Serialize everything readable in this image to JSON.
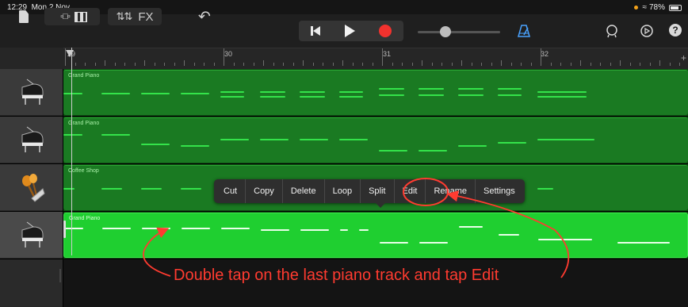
{
  "status_bar": {
    "time": "12:29",
    "date": "Mon 2 Nov",
    "battery": "78%",
    "battery_icon": "battery-icon",
    "wifi_icon": "wifi-icon"
  },
  "toolbar": {
    "fx_label": "FX",
    "icons": [
      "document-icon",
      "track-view-icon",
      "keyboard-icon",
      "mixer-icon",
      "undo-icon",
      "rewind-icon",
      "play-icon",
      "record-icon",
      "metronome-icon",
      "loop-icon",
      "settings-icon",
      "help-icon"
    ],
    "help_label": "?",
    "volume_level": 0.28,
    "colors": {
      "record": "#f2322e",
      "metronome": "#4aa3ff"
    }
  },
  "ruler": {
    "bars": [
      "29",
      "30",
      "31",
      "32"
    ],
    "plus": "+"
  },
  "tracks": [
    {
      "name": "Grand Piano",
      "instrument_icon": "grand-piano-icon",
      "selected": false
    },
    {
      "name": "Grand Piano",
      "instrument_icon": "grand-piano-icon",
      "selected": false
    },
    {
      "name": "Coffee Shop",
      "instrument_icon": "percussion-shakers-icon",
      "selected": false
    },
    {
      "name": "Grand Piano",
      "instrument_icon": "grand-piano-icon",
      "selected": true
    }
  ],
  "context_menu": {
    "items": [
      "Cut",
      "Copy",
      "Delete",
      "Loop",
      "Split",
      "Edit",
      "Rename",
      "Settings"
    ],
    "highlighted": "Edit"
  },
  "annotation": {
    "text": "Double tap on the last piano track and tap Edit",
    "color": "#ff3b30"
  }
}
